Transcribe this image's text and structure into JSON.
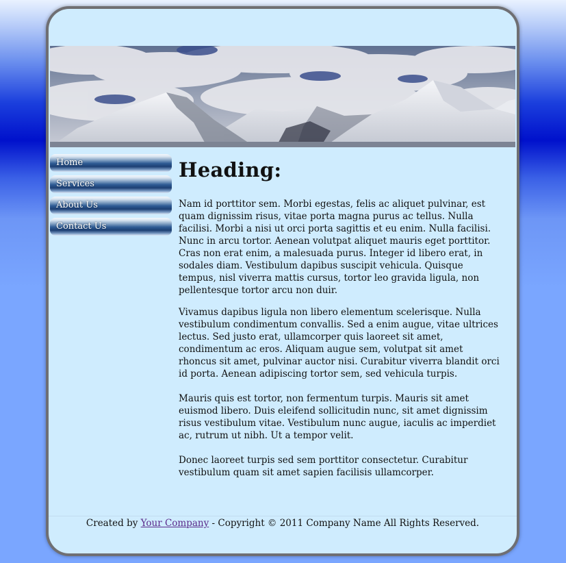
{
  "nav": {
    "items": [
      {
        "label": "Home"
      },
      {
        "label": "Services"
      },
      {
        "label": "About Us"
      },
      {
        "label": "Contact Us"
      }
    ]
  },
  "main": {
    "heading": "Heading:",
    "paragraphs": [
      "Nam id porttitor sem. Morbi egestas, felis ac aliquet pulvinar, est quam dignissim risus, vitae porta magna purus ac tellus. Nulla facilisi. Morbi a nisi ut orci porta sagittis et eu enim. Nulla facilisi. Nunc in arcu tortor. Aenean volutpat aliquet mauris eget porttitor. Cras non erat enim, a malesuada purus. Integer id libero erat, in sodales diam. Vestibulum dapibus suscipit vehicula. Quisque tempus, nisl viverra mattis cursus, tortor leo gravida ligula, non pellentesque tortor arcu non duir.",
      "Vivamus dapibus ligula non libero elementum scelerisque. Nulla vestibulum condimentum convallis. Sed a enim augue, vitae ultrices lectus. Sed justo erat, ullamcorper quis laoreet sit amet, condimentum ac eros. Aliquam augue sem, volutpat sit amet rhoncus sit amet, pulvinar auctor nisi. Curabitur viverra blandit orci id porta. Aenean adipiscing tortor sem, sed vehicula turpis.",
      "Mauris quis est tortor, non fermentum turpis. Mauris sit amet euismod libero. Duis eleifend sollicitudin nunc, sit amet dignissim risus vestibulum vitae. Vestibulum nunc augue, iaculis ac imperdiet ac, rutrum ut nibh. Ut a tempor velit.",
      "Donec laoreet turpis sed sem porttitor consectetur. Curabitur vestibulum quam sit amet sapien facilisis ullamcorper."
    ]
  },
  "footer": {
    "prefix": "Created by",
    "link": "Your Company",
    "suffix": "- Copyright © 2011 Company Name All Rights Reserved."
  },
  "colors": {
    "page_bg_top": "#e9f2ff",
    "page_bg_band": "#0011cc",
    "page_bg_bottom": "#7aa6ff",
    "panel_bg": "#cfecfe",
    "frame": "#6f6f73",
    "link": "#5a2a8a"
  },
  "banner": {
    "image": "snow-capped-mountains-under-cloudy-sky"
  }
}
